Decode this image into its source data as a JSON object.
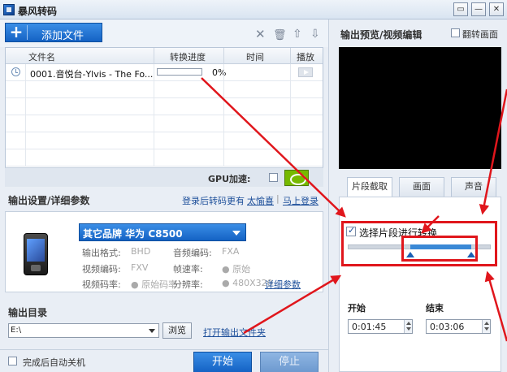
{
  "window": {
    "title": "暴风转码",
    "buttons": [
      "▭",
      "—",
      "✕"
    ]
  },
  "toolbar": {
    "add_file_label": "添加文件",
    "icons": [
      "close-icon",
      "trash-icon",
      "arrow-up-icon",
      "arrow-down-icon"
    ]
  },
  "file_table": {
    "columns": [
      "文件名",
      "转换进度",
      "时间",
      "播放"
    ],
    "rows": [
      {
        "name": "0001.音悦台-Ylvis - The Fo...",
        "progress": 0.0,
        "progress_text": "0%",
        "time": ""
      }
    ]
  },
  "gpu": {
    "label": "GPU加速:"
  },
  "settings": {
    "heading": "输出设置/详细参数",
    "login_text": "登录后转码更有",
    "login_link1": "太愉喜",
    "login_sep": "|",
    "login_link2": "马上登录",
    "brand": "其它品牌  华为  C8500",
    "params": [
      {
        "label": "输出格式:",
        "value": "BHD"
      },
      {
        "label": "音频编码:",
        "value": "FXA"
      },
      {
        "label": "视频编码:",
        "value": "FXV"
      },
      {
        "label": "帧速率:",
        "value": "● 原始"
      },
      {
        "label": "视频码率:",
        "value": "● 原始码率"
      },
      {
        "label": "分辨率:",
        "value": "● 480X320"
      }
    ],
    "detail_link": "详细参数"
  },
  "output": {
    "heading": "输出目录",
    "path": "E:\\",
    "browse_label": "浏览",
    "open_folder_link": "打开输出文件夹"
  },
  "bottom": {
    "auto_shutdown_label": "完成后自动关机",
    "start_label": "开始",
    "stop_label": "停止"
  },
  "preview": {
    "title": "输出预览/视频编辑",
    "flip_label": "翻转画面"
  },
  "tabs": [
    "片段截取",
    "画面",
    "声音"
  ],
  "clip": {
    "checkbox_label": "选择片段进行转换",
    "checked": true,
    "range_start_fraction": 0.43,
    "range_end_fraction": 0.86,
    "start_label": "开始",
    "end_label": "结束",
    "start_time": "0:01:45",
    "end_time": "0:03:06"
  },
  "colors": {
    "accent_blue": "#1462c4",
    "highlight_red": "#e0161c"
  }
}
